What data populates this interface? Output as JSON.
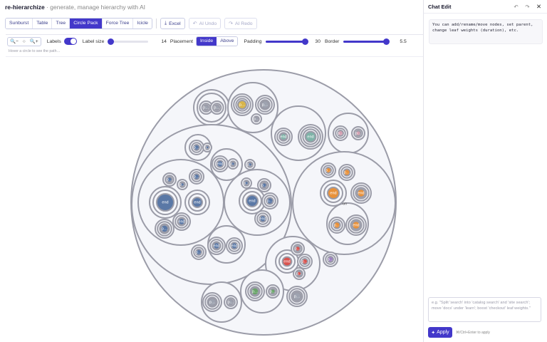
{
  "app": {
    "brand": "re-hierarchize",
    "tagline": " · generate, manage hierarchy with AI"
  },
  "toolbar": {
    "tabs": [
      "Sunburst",
      "Table",
      "Tree",
      "Circle Pack",
      "Force Tree",
      "Icicle"
    ],
    "active_tab": "Circle Pack",
    "excel_label": "Excel",
    "ai_undo_label": "AI Undo",
    "ai_redo_label": "AI Redo",
    "icons": {
      "excel": "download-icon",
      "undo": "undo-icon",
      "redo": "redo-icon"
    }
  },
  "controls": {
    "zoom_out": "🔍−",
    "zoom_reset": "○",
    "zoom_in": "🔍+",
    "labels_label": "Labels",
    "labels_on": true,
    "label_size_label": "Label size",
    "label_size_value": "14",
    "label_size_level": 0.05,
    "placement_label": "Placement",
    "placement_options": [
      "Inside",
      "Above"
    ],
    "placement_selected": "Inside",
    "padding_label": "Padding",
    "padding_value": "30",
    "padding_level": 1.0,
    "border_label": "Border",
    "border_value": "5.5",
    "border_level": 0.98,
    "hover_hint": "Hover a circle to see the path…"
  },
  "chart": {
    "colors": {
      "container": "#f5f6fa",
      "stroke": "#9b9ca8",
      "blue": "#5a78a6",
      "orange": "#e8913a",
      "red": "#d9534f",
      "green": "#6aa56a",
      "teal": "#7fb3a8",
      "pink": "#d4a0b2",
      "purple": "#9b7fc1",
      "gray": "#9ea3b0",
      "yellow": "#d8b54a"
    },
    "leaf_label": "end",
    "short_label": "p…"
  },
  "chat": {
    "title": "Chat Edit",
    "message": "You can add/rename/move nodes, set parent, change leaf weights (duration), etc.",
    "input_placeholder": "e.g. \"Split 'search' into 'catalog search' and 'site search'; move 'docs' under 'learn'; boost 'checkout' leaf weights.\"",
    "apply_label": "Apply",
    "apply_hint": "⌘/Ctrl+Enter to apply",
    "icons": {
      "undo": "undo-icon",
      "redo": "redo-icon",
      "close": "close-icon",
      "apply": "sparkle-icon"
    }
  }
}
